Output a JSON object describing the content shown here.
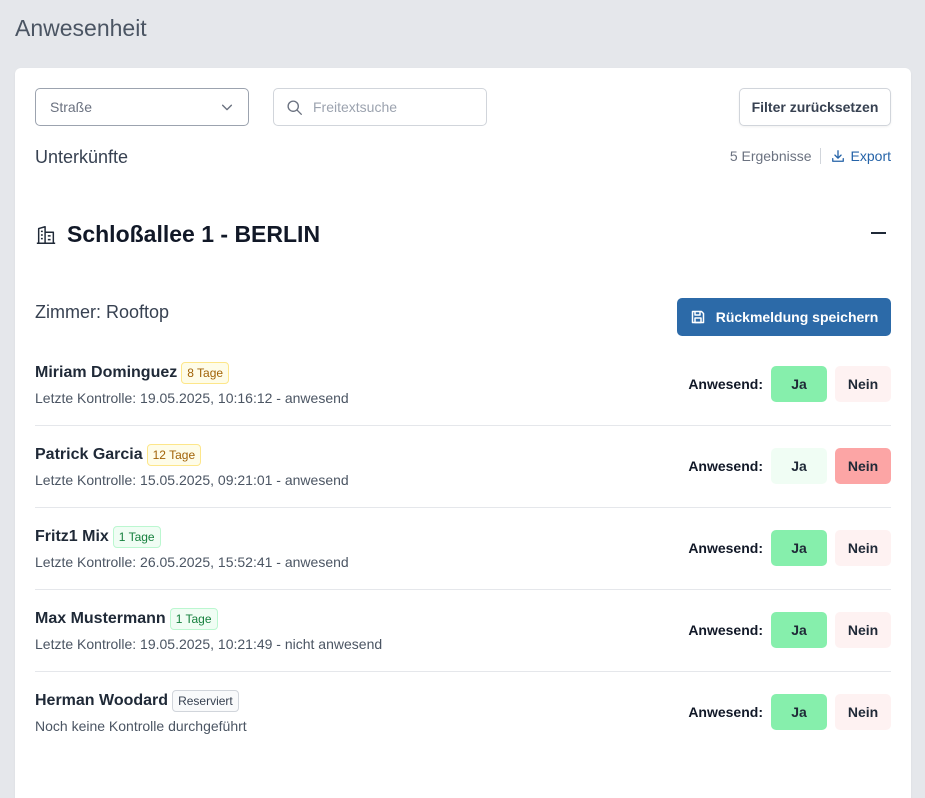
{
  "page": {
    "title": "Anwesenheit"
  },
  "filters": {
    "street_placeholder": "Straße",
    "search_placeholder": "Freitextsuche",
    "reset_label": "Filter zurücksetzen"
  },
  "section": {
    "title": "Unterkünfte",
    "results_count": "5 Ergebnisse",
    "export_label": "Export"
  },
  "building": {
    "title": "Schloßallee 1 - BERLIN"
  },
  "room": {
    "label": "Zimmer: Rooftop",
    "save_label": "Rückmeldung speichern"
  },
  "presence_label": "Anwesend:",
  "yes_label": "Ja",
  "no_label": "Nein",
  "colors": {
    "primary": "#2c6aa8",
    "yes_selected": "#86efac",
    "no_selected": "#fca5a5"
  },
  "occupants": [
    {
      "name": "Miriam Dominguez",
      "badge": "8 Tage",
      "badge_type": "warn",
      "last_check": "Letzte Kontrolle: 19.05.2025, 10:16:12 - anwesend",
      "selected": "yes"
    },
    {
      "name": "Patrick Garcia",
      "badge": "12 Tage",
      "badge_type": "warn",
      "last_check": "Letzte Kontrolle: 15.05.2025, 09:21:01 - anwesend",
      "selected": "no"
    },
    {
      "name": "Fritz1 Mix",
      "badge": "1 Tage",
      "badge_type": "ok",
      "last_check": "Letzte Kontrolle: 26.05.2025, 15:52:41 - anwesend",
      "selected": "yes"
    },
    {
      "name": "Max Mustermann",
      "badge": "1 Tage",
      "badge_type": "ok",
      "last_check": "Letzte Kontrolle: 19.05.2025, 10:21:49 - nicht anwesend",
      "selected": "yes"
    },
    {
      "name": "Herman Woodard",
      "badge": "Reserviert",
      "badge_type": "neutral",
      "last_check": "Noch keine Kontrolle durchgeführt",
      "selected": "yes"
    }
  ]
}
